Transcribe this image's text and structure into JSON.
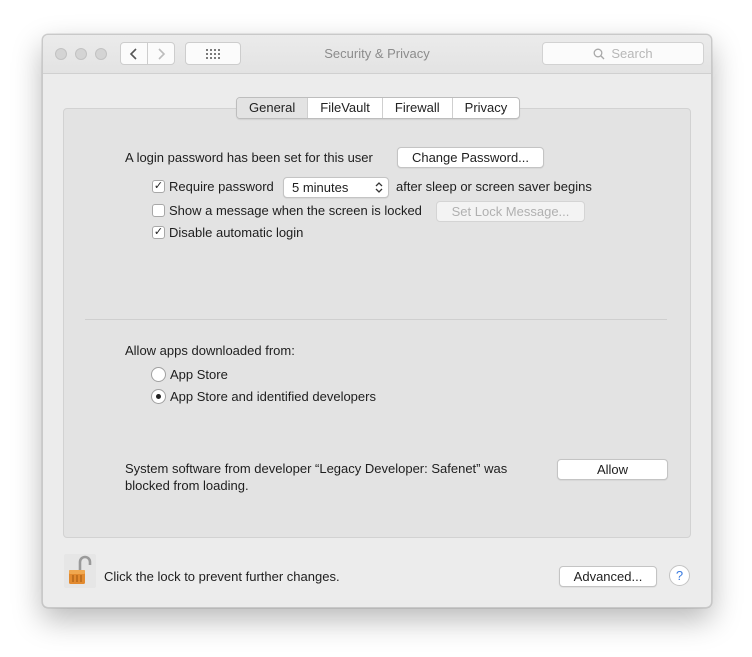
{
  "window": {
    "title": "Security & Privacy"
  },
  "toolbar": {
    "search_placeholder": "Search"
  },
  "tabs": [
    {
      "label": "General",
      "selected": true
    },
    {
      "label": "FileVault",
      "selected": false
    },
    {
      "label": "Firewall",
      "selected": false
    },
    {
      "label": "Privacy",
      "selected": false
    }
  ],
  "general": {
    "login_password_text": "A login password has been set for this user",
    "change_password_label": "Change Password...",
    "require_password": {
      "label": "Require password",
      "checked": true,
      "select_value": "5 minutes",
      "suffix": "after sleep or screen saver begins"
    },
    "show_message": {
      "label": "Show a message when the screen is locked",
      "checked": false,
      "button_label": "Set Lock Message..."
    },
    "disable_autologin": {
      "label": "Disable automatic login",
      "checked": true
    }
  },
  "apps": {
    "heading": "Allow apps downloaded from:",
    "options": [
      {
        "label": "App Store",
        "selected": false
      },
      {
        "label": "App Store and identified developers",
        "selected": true
      }
    ]
  },
  "blocked": {
    "line1": "System software from developer “Legacy Developer: Safenet” was",
    "line2": "blocked from loading.",
    "allow_label": "Allow"
  },
  "footer": {
    "lock_text": "Click the lock to prevent further changes.",
    "advanced_label": "Advanced...",
    "help_label": "?"
  },
  "icons": [
    "back-chevron-icon",
    "forward-chevron-icon",
    "grid-icon",
    "search-icon",
    "padlock-open-icon",
    "checkmark-icon",
    "updown-chevron-icon"
  ]
}
